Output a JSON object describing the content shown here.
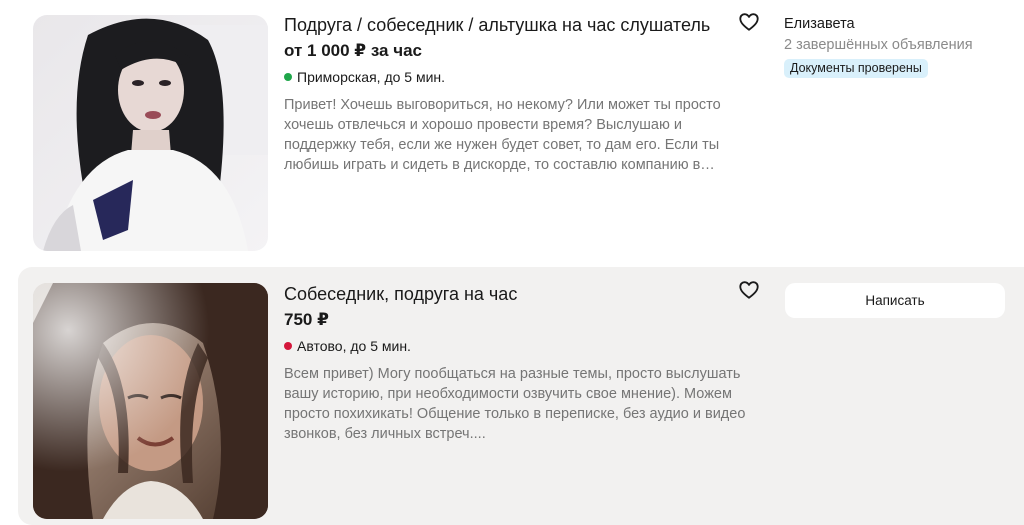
{
  "listings": [
    {
      "title": "Подруга / собеседник / альтушка на час слушатель",
      "price": "от 1 000 ₽ за час",
      "location": "Приморская, до 5 мин.",
      "metro_color": "#1fa64a",
      "description": "Привет! Хочешь выговориться, но некому? Или может ты просто хочешь отвлечься и хорошо провести время? Выслушаю и поддержку тебя, если же нужен будет совет, то дам его. Если ты любишь играть и сидеть в дискорде, то составлю компанию в…",
      "seller": {
        "name": "Елизавета",
        "ads": "2 завершённых объявления",
        "badge": "Документы проверены"
      },
      "favorite_icon": "heart-outline-icon"
    },
    {
      "title": "Собеседник, подруга на час",
      "price": "750 ₽",
      "location": "Автово, до 5 мин.",
      "metro_color": "#d4173b",
      "description": "Всем привет) Могу пообщаться на разные темы, просто выслушать вашу историю, при необходимости озвучить свое мнение). Можем просто похихикать! Общение только в переписке, без аудио и видео звонков, без личных встреч....",
      "write_button": "Написать",
      "favorite_icon": "heart-outline-icon"
    }
  ],
  "colors": {
    "badge_bg": "#d9f0fb",
    "highlight_bg": "#f2f1f0",
    "muted_text": "#757575"
  }
}
